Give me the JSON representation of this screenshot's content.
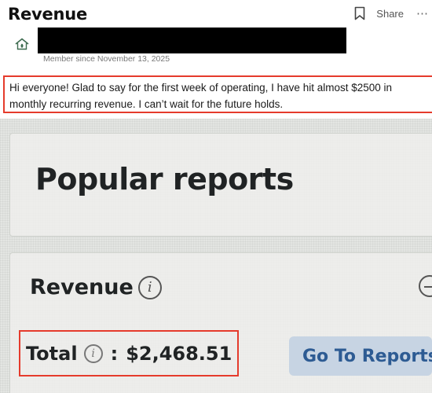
{
  "post": {
    "title": "Revenue",
    "share_label": "Share",
    "member_since": "Member since November 13, 2025",
    "body": "Hi everyone! Glad to say for the first week of operating, I have hit almost $2500 in monthly recurring revenue. I can’t wait for the future holds."
  },
  "icons": {
    "bookmark": "bookmark-icon",
    "more": "more-icon",
    "avatar": "home-logo-icon",
    "info": "info-icon",
    "collapse": "minus-circle-icon"
  },
  "dashboard_photo": {
    "popular_title": "Popular reports",
    "revenue_heading": "Revenue",
    "info_glyph": "i",
    "total_label": "Total",
    "total_colon": ":",
    "total_value": "$2,468.51",
    "goto_button": "Go To Reports"
  },
  "colors": {
    "highlight_border": "#e53b2c",
    "button_bg": "#c7d4e3",
    "button_text": "#2d5b93"
  }
}
